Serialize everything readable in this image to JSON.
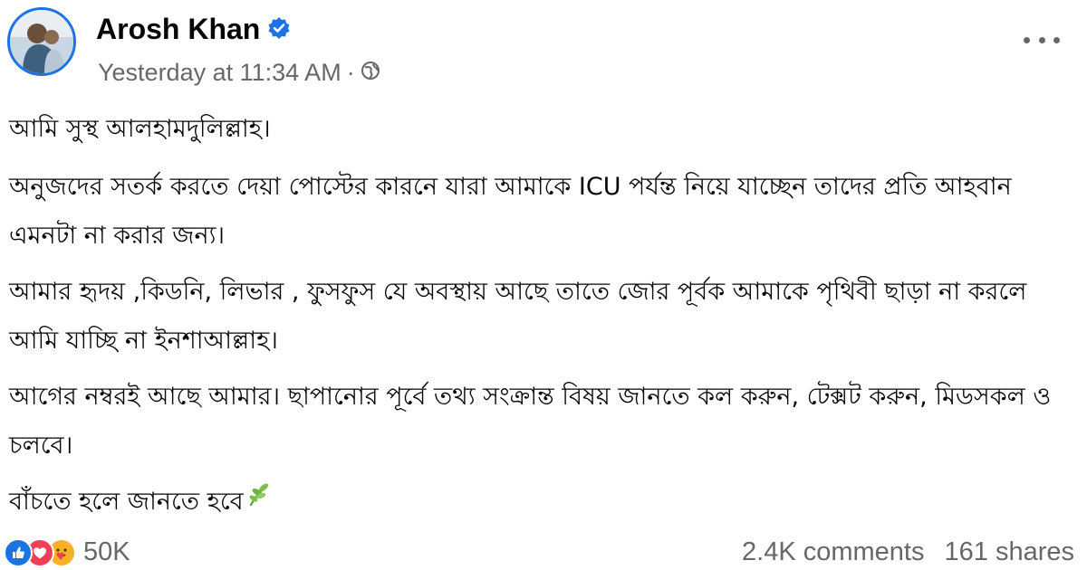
{
  "post": {
    "author": "Arosh Khan",
    "timestamp": "Yesterday at 11:34 AM",
    "separator": "·",
    "audience_icon": "globe-icon",
    "verified_icon": "verified-badge-icon",
    "more_icon": "more-options-icon",
    "paragraphs": [
      "আমি সুস্থ আলহামদুলিল্লাহ।",
      "অনুজদের সতর্ক করতে দেয়া পোস্টের কারনে যারা আমাকে ICU পর্যন্ত নিয়ে যাচ্ছেন তাদের প্রতি আহবান এমনটা না করার জন্য।",
      "আমার হৃদয় ,কিডনি, লিভার , ফুসফুস যে অবস্থায় আছে তাতে জোর পূর্বক আমাকে পৃথিবী ছাড়া না করলে আমি যাচ্ছি না ইনশাআল্লাহ।",
      "আগের নম্বরই আছে আমার।  ছাপানোর পূর্বে তথ্য সংক্রান্ত বিষয় জানতে কল করুন, টেক্সট করুন, মিডসকল ও চলবে।",
      "বাঁচতে হলে জানতে হবে"
    ],
    "trailing_emoji": "herb-emoji"
  },
  "footer": {
    "reaction_icons": [
      "like-reaction-icon",
      "love-reaction-icon",
      "care-reaction-icon"
    ],
    "reactions_count": "50K",
    "comments": "2.4K comments",
    "shares": "161 shares"
  },
  "colors": {
    "brand_blue": "#1b74e4",
    "love_red": "#f33e58",
    "care_yellow": "#f7b125",
    "meta_gray": "#65676b",
    "text": "#050505"
  }
}
